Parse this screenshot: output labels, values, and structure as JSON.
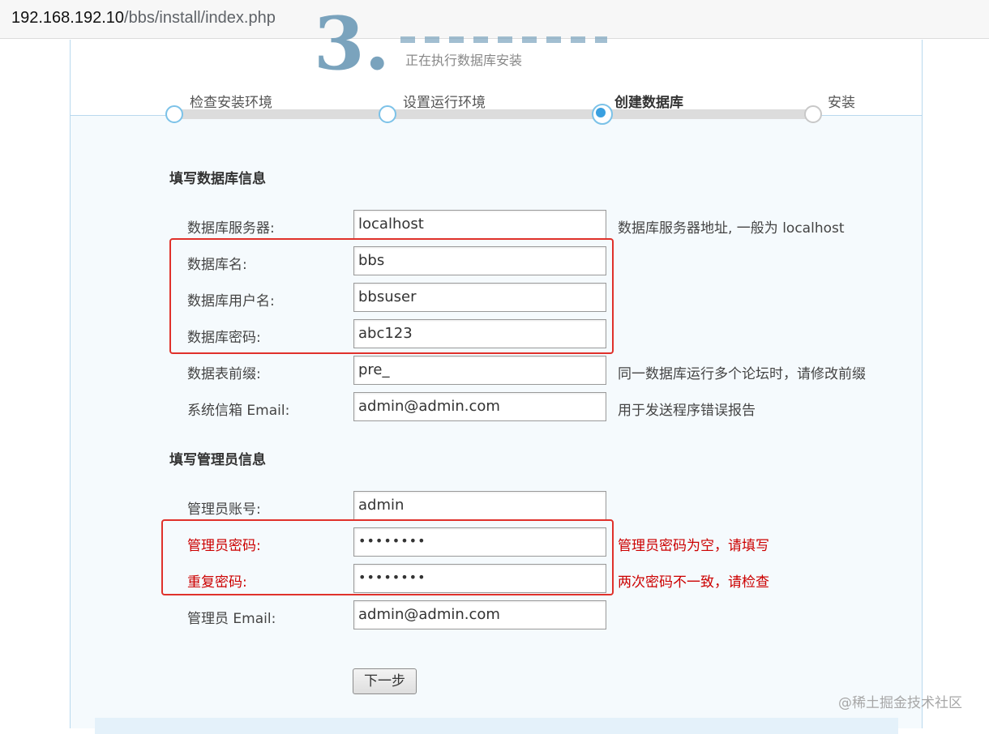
{
  "browser": {
    "url_host": "192.168.192.10",
    "url_path": "/bbs/install/index.php"
  },
  "header": {
    "step_number": "3.",
    "subtitle": "正在执行数据库安装"
  },
  "steps": [
    {
      "label": "检查安装环境",
      "state": "done"
    },
    {
      "label": "设置运行环境",
      "state": "done"
    },
    {
      "label": "创建数据库",
      "state": "current"
    },
    {
      "label": "安装",
      "state": "todo"
    }
  ],
  "db_section": {
    "title": "填写数据库信息",
    "rows": [
      {
        "label": "数据库服务器:",
        "value": "localhost",
        "hint": "数据库服务器地址, 一般为 localhost"
      },
      {
        "label": "数据库名:",
        "value": "bbs",
        "hint": ""
      },
      {
        "label": "数据库用户名:",
        "value": "bbsuser",
        "hint": ""
      },
      {
        "label": "数据库密码:",
        "value": "abc123",
        "hint": ""
      },
      {
        "label": "数据表前缀:",
        "value": "pre_",
        "hint": "同一数据库运行多个论坛时，请修改前缀"
      },
      {
        "label": "系统信箱 Email:",
        "value": "admin@admin.com",
        "hint": "用于发送程序错误报告"
      }
    ]
  },
  "admin_section": {
    "title": "填写管理员信息",
    "rows": [
      {
        "label": "管理员账号:",
        "value": "admin",
        "hint": "",
        "error": false
      },
      {
        "label": "管理员密码:",
        "value": "••••••••",
        "hint": "管理员密码为空，请填写",
        "error": true
      },
      {
        "label": "重复密码:",
        "value": "••••••••",
        "hint": "两次密码不一致，请检查",
        "error": true
      },
      {
        "label": "管理员 Email:",
        "value": "admin@admin.com",
        "hint": "",
        "error": false
      }
    ]
  },
  "next_button": "下一步",
  "watermark": "@稀土掘金技术社区",
  "colors": {
    "error": "#cc0000",
    "annotation_box": "#e0312b",
    "step_active": "#3aa0e0"
  }
}
